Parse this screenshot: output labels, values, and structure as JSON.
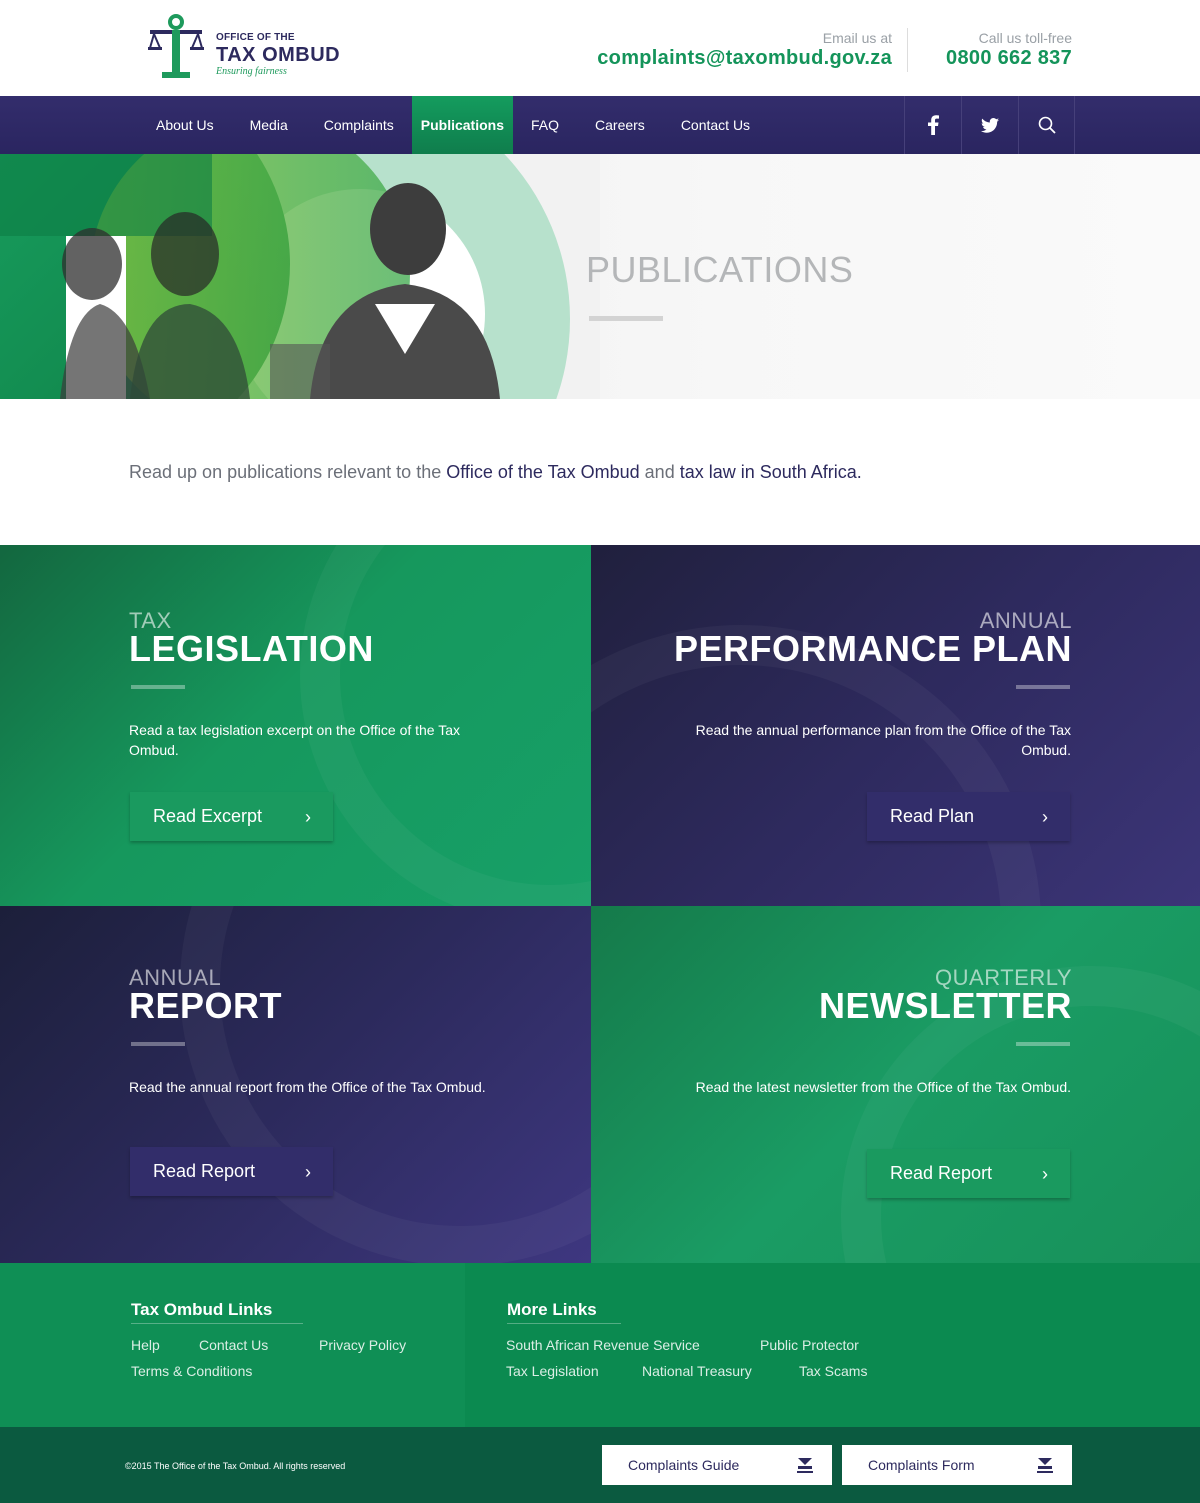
{
  "header": {
    "logo": {
      "line1": "OFFICE OF THE",
      "line2": "TAX OMBUD",
      "tagline": "Ensuring fairness"
    },
    "email_label": "Email us at",
    "email_value": "complaints@taxombud.gov.za",
    "phone_label": "Call us toll-free",
    "phone_value": "0800 662 837"
  },
  "nav": {
    "items": [
      {
        "label": "About Us"
      },
      {
        "label": "Media"
      },
      {
        "label": "Complaints"
      },
      {
        "label": "Publications",
        "active": true
      },
      {
        "label": "FAQ"
      },
      {
        "label": "Careers"
      },
      {
        "label": "Contact Us"
      }
    ],
    "icons": [
      "facebook-icon",
      "twitter-icon",
      "search-icon"
    ]
  },
  "hero": {
    "title": "PUBLICATIONS"
  },
  "intro": {
    "text1": "Read up on publications relevant to the ",
    "link1": "Office of the Tax Ombud",
    "text2": " and ",
    "link2": "tax law in South Africa."
  },
  "tiles": [
    {
      "kicker": "TAX",
      "title": "LEGISLATION",
      "desc": "Read a tax legislation excerpt on the Office of the Tax Ombud.",
      "button": "Read Excerpt"
    },
    {
      "kicker": "ANNUAL",
      "title": "PERFORMANCE PLAN",
      "desc": "Read the annual performance plan from the Office of the Tax Ombud.",
      "button": "Read Plan"
    },
    {
      "kicker": "ANNUAL",
      "title": "REPORT",
      "desc": "Read the annual report from the Office of the Tax Ombud.",
      "button": "Read Report"
    },
    {
      "kicker": "QUARTERLY",
      "title": "NEWSLETTER",
      "desc": "Read the latest newsletter from the Office of the Tax Ombud.",
      "button": "Read Report"
    }
  ],
  "footer": {
    "col1": {
      "heading": "Tax Ombud Links",
      "links": [
        "Help",
        "Contact Us",
        "Privacy Policy",
        "Terms & Conditions"
      ]
    },
    "col2": {
      "heading": "More Links",
      "links": [
        "South African Revenue Service",
        "Public Protector",
        "Tax Legislation",
        "National Treasury",
        "Tax Scams"
      ]
    }
  },
  "bottom": {
    "copyright": "©2015 The Office of the Tax Ombud. All rights reserved",
    "guide": "Complaints Guide",
    "form": "Complaints Form"
  },
  "colors": {
    "green": "#14945a",
    "purple": "#2d2a5e",
    "footer_green": "#0f8f55",
    "bottom_bar": "#0b5a40"
  }
}
